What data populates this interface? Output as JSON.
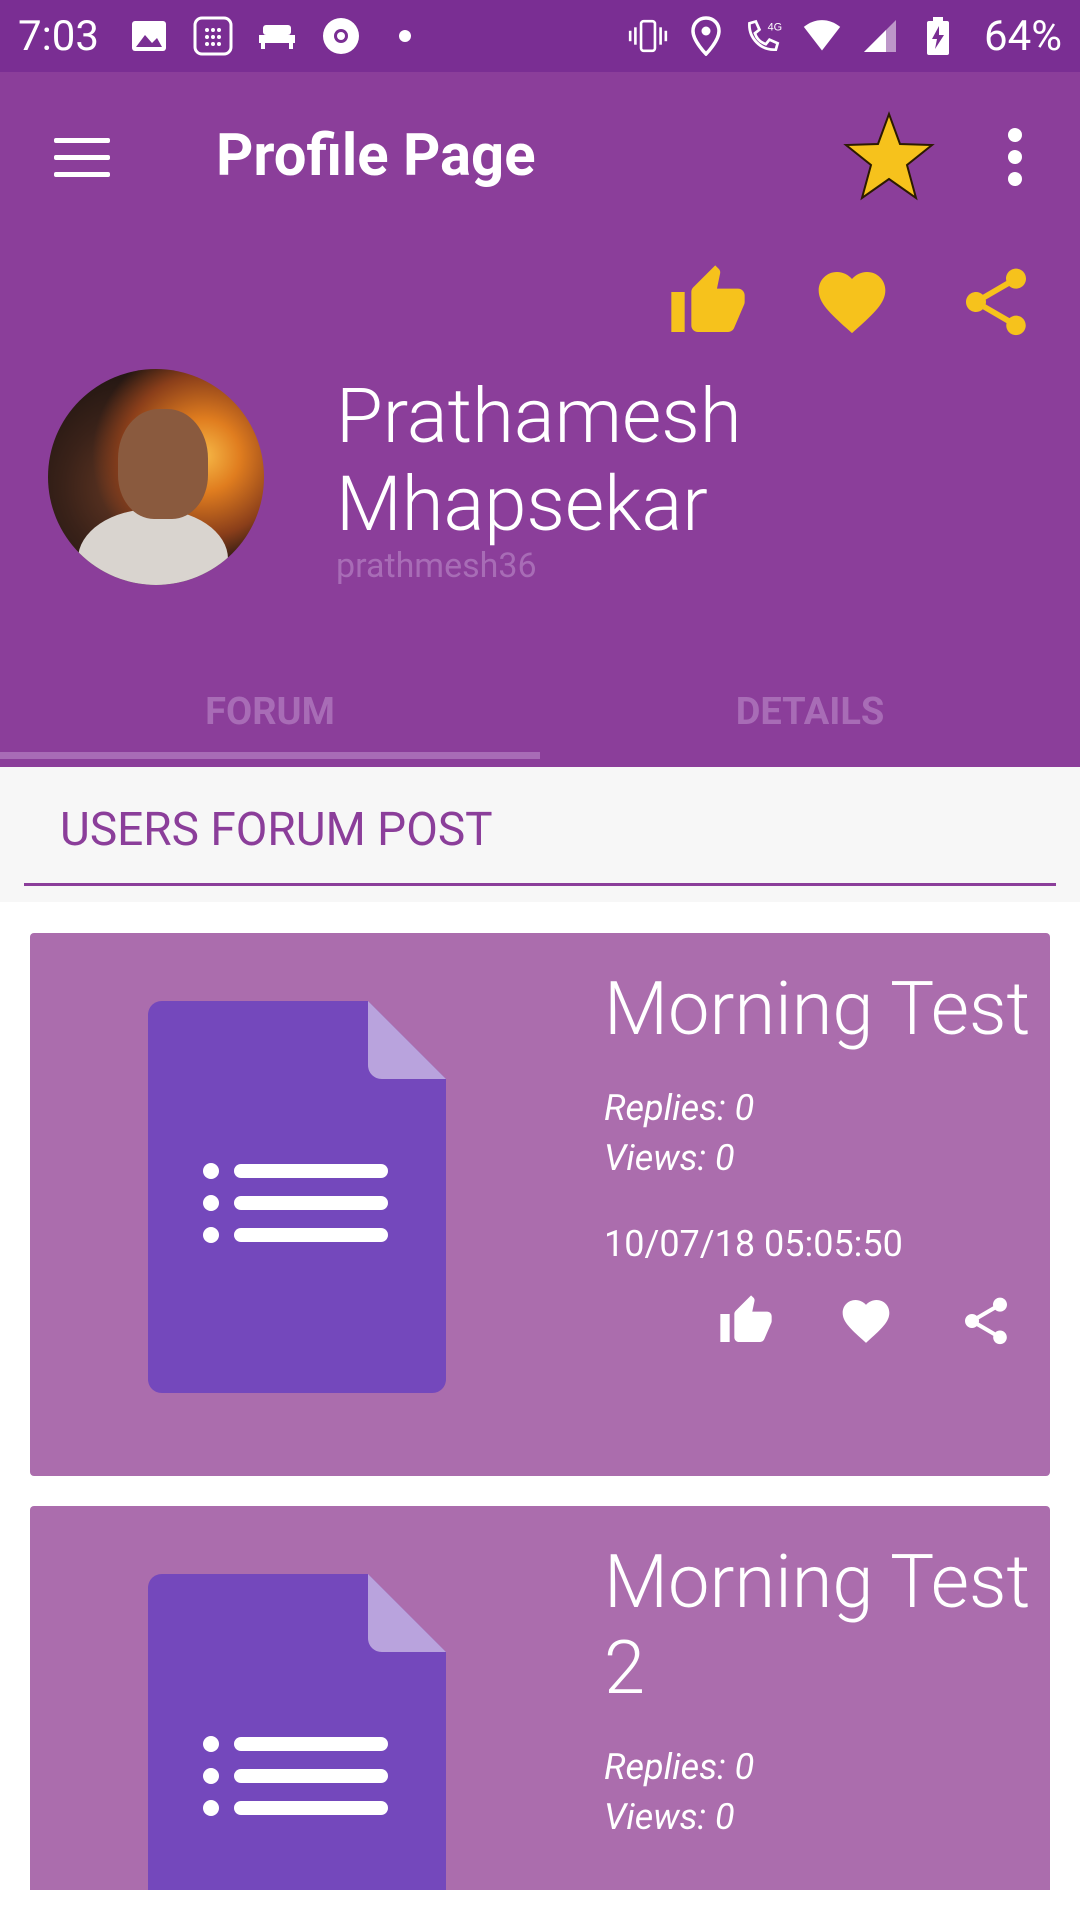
{
  "status_bar": {
    "time": "7:03",
    "network": "4G",
    "battery": "64%"
  },
  "toolbar": {
    "title": "Profile Page"
  },
  "profile": {
    "name_line1": "Prathamesh",
    "name_line2": "Mhapsekar",
    "username": "prathmesh36"
  },
  "tabs": [
    {
      "label": "FORUM",
      "selected": true
    },
    {
      "label": "DETAILS",
      "selected": false
    }
  ],
  "section": {
    "title": "USERS FORUM POST"
  },
  "posts": [
    {
      "title": "Morning Test",
      "replies": "Replies: 0",
      "views": "Views: 0",
      "date": "10/07/18 05:05:50"
    },
    {
      "title_line1": "Morning Test",
      "title_line2": "2",
      "replies": "Replies: 0",
      "views": "Views: 0"
    }
  ],
  "colors": {
    "status_bar": "#7a2e93",
    "header": "#8b3e9a",
    "accent_yellow": "#f6c21c",
    "card": "#ab6dad",
    "doc_icon": "#7448bc"
  },
  "icons": [
    "menu-icon",
    "star-icon",
    "overflow-icon",
    "thumbs-up-icon",
    "heart-icon",
    "share-icon",
    "document-icon"
  ]
}
